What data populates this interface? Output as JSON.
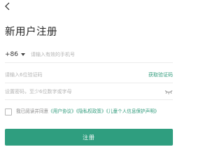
{
  "header": {
    "back_icon": "chevron-left-icon"
  },
  "page": {
    "title": "新用户注册"
  },
  "phone": {
    "country_code": "+86",
    "placeholder": "请输入有效的手机号",
    "value": ""
  },
  "code": {
    "placeholder": "请输入6位验证码",
    "value": "",
    "get_code_label": "获取验证码"
  },
  "password": {
    "placeholder": "设置密码，至少6位数字或字母",
    "value": "",
    "visibility_icon": "eye-closed-icon"
  },
  "agreement": {
    "checked": false,
    "prefix": "我已阅读并同意",
    "user_agreement": "《用户协议》",
    "privacy_policy": "《隐私权政策》",
    "child_protection": "《儿童个人信息保护声明》"
  },
  "submit": {
    "label": "注册"
  },
  "colors": {
    "accent": "#2f9e7f",
    "link": "#2e9a7a"
  }
}
